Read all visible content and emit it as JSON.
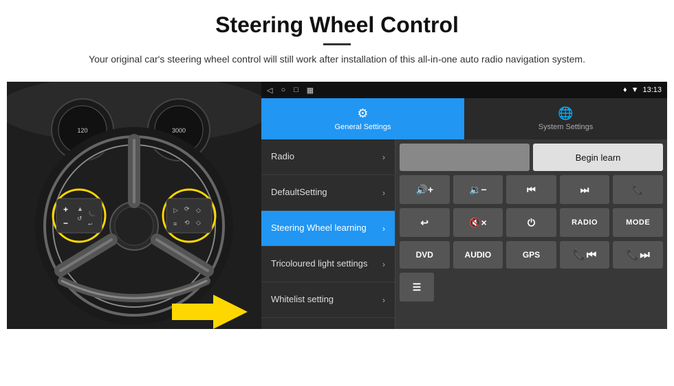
{
  "header": {
    "title": "Steering Wheel Control",
    "subtitle": "Your original car's steering wheel control will still work after installation of this all-in-one auto radio navigation system."
  },
  "statusBar": {
    "time": "13:13",
    "icons": [
      "◁",
      "○",
      "□",
      "▦"
    ]
  },
  "tabs": [
    {
      "id": "general",
      "label": "General Settings",
      "icon": "⚙",
      "active": true
    },
    {
      "id": "system",
      "label": "System Settings",
      "icon": "🌐",
      "active": false
    }
  ],
  "menuItems": [
    {
      "id": "radio",
      "label": "Radio",
      "active": false
    },
    {
      "id": "default",
      "label": "DefaultSetting",
      "active": false
    },
    {
      "id": "steering",
      "label": "Steering Wheel learning",
      "active": true
    },
    {
      "id": "tricoloured",
      "label": "Tricoloured light settings",
      "active": false
    },
    {
      "id": "whitelist",
      "label": "Whitelist setting",
      "active": false
    }
  ],
  "controls": {
    "beginLearnLabel": "Begin learn",
    "row1": [
      {
        "id": "vol-up",
        "symbol": "🔊+",
        "label": "🔊+"
      },
      {
        "id": "vol-down",
        "symbol": "🔉−",
        "label": "🔉−"
      },
      {
        "id": "prev-track",
        "symbol": "⏮",
        "label": "⏮"
      },
      {
        "id": "next-track",
        "symbol": "⏭",
        "label": "⏭"
      },
      {
        "id": "phone",
        "symbol": "📞",
        "label": "📞"
      }
    ],
    "row2": [
      {
        "id": "hang-up",
        "symbol": "↩",
        "label": "↩"
      },
      {
        "id": "mute",
        "symbol": "🔇",
        "label": "🔇×"
      },
      {
        "id": "power",
        "symbol": "⏻",
        "label": "⏻"
      },
      {
        "id": "radio-btn",
        "symbol": "RADIO",
        "label": "RADIO"
      },
      {
        "id": "mode",
        "symbol": "MODE",
        "label": "MODE"
      }
    ],
    "row3": [
      {
        "id": "dvd",
        "symbol": "DVD",
        "label": "DVD"
      },
      {
        "id": "audio",
        "symbol": "AUDIO",
        "label": "AUDIO"
      },
      {
        "id": "gps",
        "symbol": "GPS",
        "label": "GPS"
      },
      {
        "id": "tel-prev",
        "symbol": "📞⏮",
        "label": "📞⏮"
      },
      {
        "id": "tel-next",
        "symbol": "📞⏭",
        "label": "📞⏭"
      }
    ],
    "row4": [
      {
        "id": "list-icon",
        "symbol": "≡",
        "label": "≡"
      }
    ]
  }
}
